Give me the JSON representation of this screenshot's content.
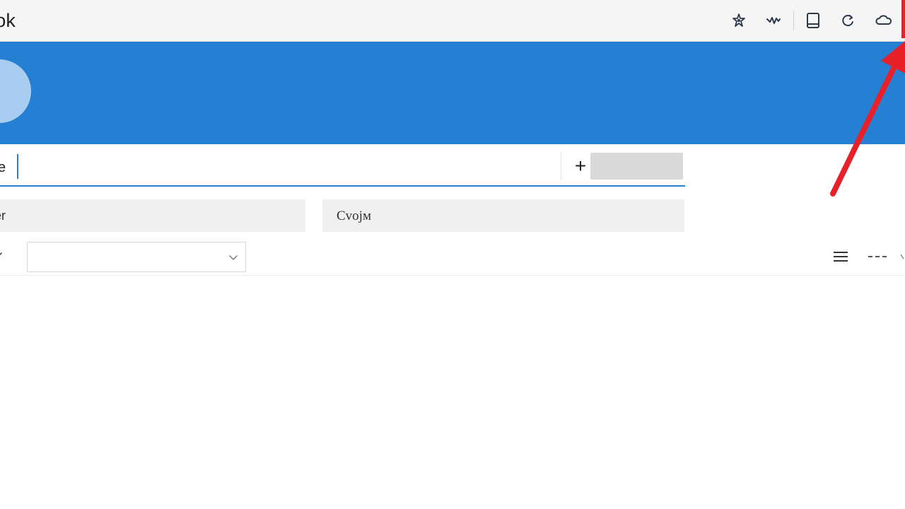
{
  "app": {
    "title": "ook"
  },
  "toolbar": {
    "icons": [
      "star-settings-icon",
      "wave-icon",
      "notebook-icon",
      "sync-icon",
      "cloud-icon"
    ]
  },
  "form": {
    "name_label": "e",
    "name_value": "",
    "add_symbol": "+",
    "field_left_text": "er",
    "field_right_text": "Cvojм",
    "dropdown_value": ""
  },
  "colors": {
    "accent": "#2580d4",
    "avatar": "#a9cdf0",
    "annotation": "#e8202a"
  }
}
